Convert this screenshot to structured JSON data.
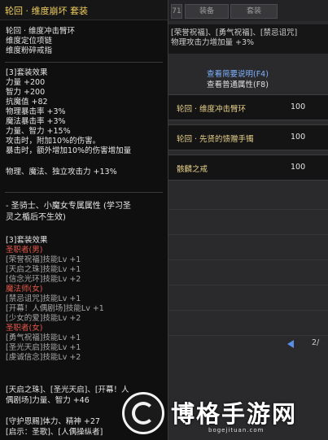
{
  "tooltip": {
    "title": "轮回 · 维度崩坏  套装",
    "intro": [
      "轮回 · 维度冲击臂环",
      "维度定位项链",
      "维度粉碎戒指"
    ],
    "set3_header": "[3]套装效果",
    "stats": [
      "力量 +200",
      "智力 +200",
      "抗魔值 +82",
      "物理暴击率 +3%",
      "魔法暴击率 +3%",
      "力量、智力 +15%"
    ],
    "attack_lines": [
      "攻击时，附加10%的伤害。",
      "暴击时，额外增加10%的伤害增加量"
    ],
    "independent": "物理、魔法、独立攻击力 +13%",
    "special_title": [
      "- 圣骑士、小魔女专属属性 (学习圣",
      "灵之楯后不生效)"
    ],
    "special_header": "[3]套装效果",
    "class_blocks": [
      {
        "class_name": "圣职者(男)",
        "skills": [
          "[荣誉祝福]技能Lv +1",
          "[天启之珠]技能Lv +1",
          "[信念光环]技能Lv +2"
        ]
      },
      {
        "class_name": "魔法师(女)",
        "skills": [
          "[禁忌诅咒]技能Lv +1",
          "[开幕！人偶剧场]技能Lv +1",
          "[少女的爱]技能Lv +2"
        ]
      },
      {
        "class_name": "圣职者(女)",
        "skills": [
          "[勇气祝福]技能Lv +1",
          "[圣光天启]技能Lv +1",
          "[虔诚信念]技能Lv +2"
        ]
      }
    ],
    "bottom_lines": [
      "[天启之珠]、[圣光天启]、[开幕！人",
      "偶剧场]力量、智力 +46",
      "",
      "[守护恩赐]体力、精神 +27",
      "[启示：圣歌]、[人偶操纵者]"
    ]
  },
  "right_panel": {
    "tabs": [
      "装备",
      "套装"
    ],
    "level_tag": "71",
    "info_lines": [
      "[荣誉祝福]、[勇气祝福]、[禁忌诅咒]",
      "物理攻击力增加量 +3%"
    ],
    "links": {
      "simple": "查看简要说明(F4)",
      "normal": "查看普通属性(F8)"
    },
    "set_items": [
      {
        "name": "轮回 · 维度冲击臂环",
        "value": "100"
      },
      {
        "name": "轮回 · 先贤的馈赠手镯",
        "value": "100"
      },
      {
        "name": "骸麟之戒",
        "value": "100"
      }
    ],
    "pager": "2/"
  },
  "watermark": {
    "brand": "博格手游网",
    "url": "bogejituan.com"
  },
  "colors": {
    "title": "#f0d060",
    "class_red": "#e65a4a",
    "item_gold": "#e8d28a",
    "link_blue": "#7fb3ff"
  }
}
